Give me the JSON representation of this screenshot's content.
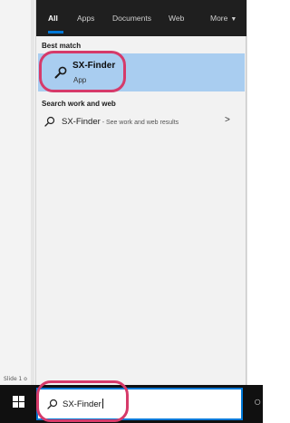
{
  "tabs": {
    "all": "All",
    "apps": "Apps",
    "documents": "Documents",
    "web": "Web",
    "more": "More"
  },
  "sections": {
    "best_match": "Best match",
    "search_web": "Search work and web"
  },
  "best_match_item": {
    "title": "SX-Finder",
    "subtitle": "App",
    "icon": "magnifier-app-icon"
  },
  "web_item": {
    "title": "SX-Finder",
    "subtitle": " - See work and web results",
    "arrow": ">",
    "icon": "search-icon"
  },
  "search": {
    "value": "SX-Finder"
  },
  "background": {
    "slide_label": "Slide 1 o"
  },
  "colors": {
    "accent": "#0078d7",
    "selection": "#a9cdf0",
    "annotation": "#d63a6a",
    "taskbar": "#101010"
  }
}
